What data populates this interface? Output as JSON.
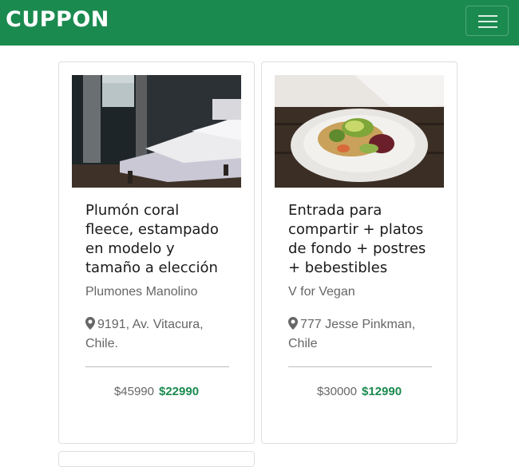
{
  "colors": {
    "brand": "#1b8a4f"
  },
  "navbar": {
    "brand": "CUPPON",
    "menu_icon": "hamburger-menu-icon"
  },
  "cards": [
    {
      "title": "Plumón coral fleece, estampado en modelo y tamaño a elección",
      "vendor": "Plumones Manolino",
      "address": "9191, Av. Vitacura, Chile.",
      "old_price": "$45990",
      "new_price": "$22990",
      "icon": "map-marker-icon"
    },
    {
      "title": "Entrada para compartir + platos de fondo + postres + bebestibles",
      "vendor": "V for Vegan",
      "address": "777 Jesse Pinkman, Chile",
      "old_price": "$30000",
      "new_price": "$12990",
      "icon": "map-marker-icon"
    }
  ]
}
